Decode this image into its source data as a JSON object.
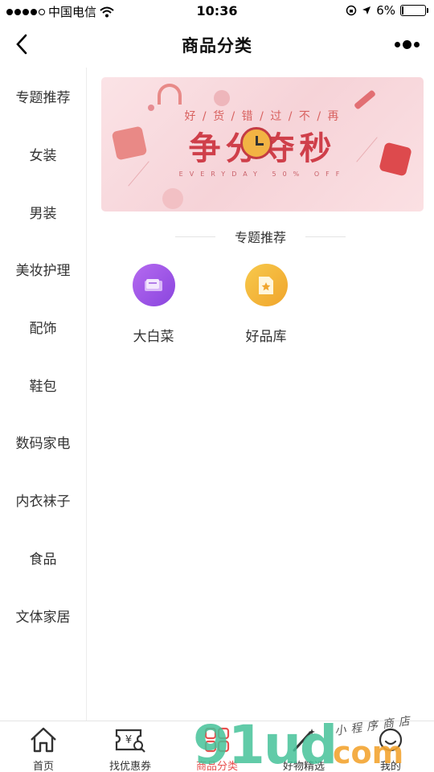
{
  "status_bar": {
    "carrier": "中国电信",
    "time": "10:36",
    "battery_percent": "6%",
    "battery_level": 0.06
  },
  "nav": {
    "title": "商品分类"
  },
  "sidebar": {
    "items": [
      {
        "label": "专题推荐",
        "active": true
      },
      {
        "label": "女装"
      },
      {
        "label": "男装"
      },
      {
        "label": "美妆护理"
      },
      {
        "label": "配饰"
      },
      {
        "label": "鞋包"
      },
      {
        "label": "数码家电"
      },
      {
        "label": "内衣袜子"
      },
      {
        "label": "食品"
      },
      {
        "label": "文体家居"
      }
    ]
  },
  "banner": {
    "subtitle": "好 / 货 / 错 / 过 / 不 / 再",
    "headline": "争分夺秒",
    "english": "EVERYDAY 50% OFF"
  },
  "section": {
    "title": "专题推荐"
  },
  "categories": [
    {
      "label": "大白菜",
      "color": "#a055e8",
      "icon": "ticket-icon"
    },
    {
      "label": "好品库",
      "color": "#f2b53a",
      "icon": "star-document-icon"
    }
  ],
  "tab_bar": {
    "tabs": [
      {
        "label": "首页",
        "icon": "home-icon"
      },
      {
        "label": "找优惠券",
        "icon": "coupon-search-icon"
      },
      {
        "label": "商品分类",
        "icon": "category-grid-icon",
        "active": true
      },
      {
        "label": "好物精选",
        "icon": "wand-icon"
      },
      {
        "label": "我的",
        "icon": "profile-icon"
      }
    ]
  },
  "watermark": {
    "main": "91ud",
    "suffix": "com",
    "note": "小程序商店"
  },
  "colors": {
    "accent": "#e8504f",
    "watermark_green": "#46c29a",
    "watermark_orange": "#f3a531"
  }
}
